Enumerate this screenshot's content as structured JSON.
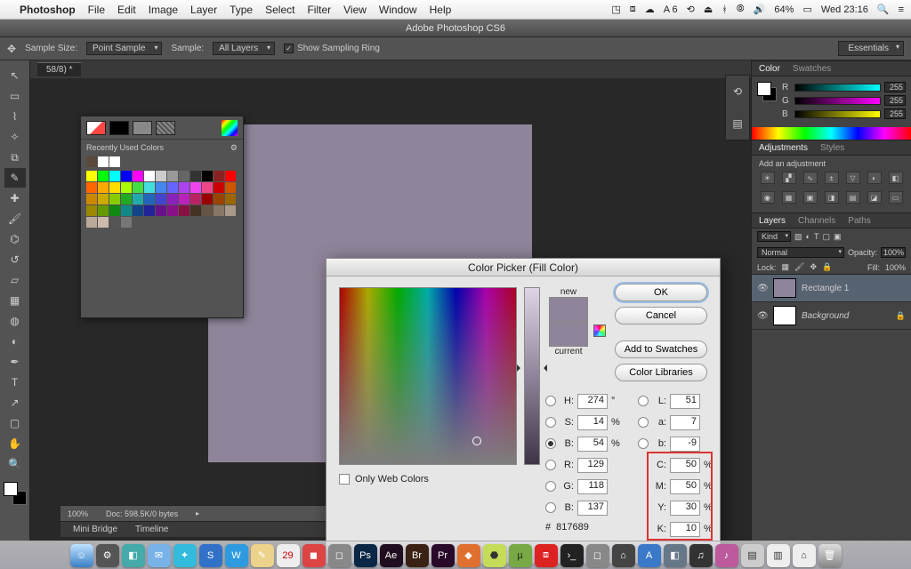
{
  "menubar": {
    "app_name": "Photoshop",
    "items": [
      "File",
      "Edit",
      "Image",
      "Layer",
      "Type",
      "Select",
      "Filter",
      "View",
      "Window",
      "Help"
    ],
    "battery": "64%",
    "clock": "Wed 23:16"
  },
  "app_title": "Adobe Photoshop CS6",
  "options": {
    "sample_size_label": "Sample Size:",
    "sample_size_value": "Point Sample",
    "sample_label": "Sample:",
    "sample_value": "All Layers",
    "show_sampling_ring": "Show Sampling Ring",
    "workspace": "Essentials"
  },
  "doc_tab": "58/8) *",
  "recent_panel_title": "Recently Used Colors",
  "right": {
    "color_tab": "Color",
    "swatches_tab": "Swatches",
    "rgb": {
      "r_label": "R",
      "r_val": "255",
      "g_label": "G",
      "g_val": "255",
      "b_label": "B",
      "b_val": "255"
    },
    "adjustments_tab": "Adjustments",
    "styles_tab": "Styles",
    "add_adjustment": "Add an adjustment",
    "layers_tab": "Layers",
    "channels_tab": "Channels",
    "paths_tab": "Paths",
    "kind": "Kind",
    "blend_mode": "Normal",
    "opacity_label": "Opacity:",
    "opacity_val": "100%",
    "lock_label": "Lock:",
    "fill_label": "Fill:",
    "fill_val": "100%",
    "layer1": "Rectangle 1",
    "layer2": "Background"
  },
  "status": {
    "zoom": "100%",
    "doc": "Doc: 598.5K/0 bytes"
  },
  "mini_tabs": {
    "a": "Mini Bridge",
    "b": "Timeline"
  },
  "picker": {
    "title": "Color Picker (Fill Color)",
    "new_label": "new",
    "current_label": "current",
    "ok": "OK",
    "cancel": "Cancel",
    "add_swatches": "Add to Swatches",
    "libraries": "Color Libraries",
    "web_only": "Only Web Colors",
    "H": {
      "l": "H:",
      "v": "274",
      "u": "°"
    },
    "S": {
      "l": "S:",
      "v": "14",
      "u": "%"
    },
    "Br": {
      "l": "B:",
      "v": "54",
      "u": "%"
    },
    "R": {
      "l": "R:",
      "v": "129",
      "u": ""
    },
    "G": {
      "l": "G:",
      "v": "118",
      "u": ""
    },
    "Bc": {
      "l": "B:",
      "v": "137",
      "u": ""
    },
    "L": {
      "l": "L:",
      "v": "51",
      "u": ""
    },
    "a": {
      "l": "a:",
      "v": "7",
      "u": ""
    },
    "b": {
      "l": "b:",
      "v": "-9",
      "u": ""
    },
    "C": {
      "l": "C:",
      "v": "50",
      "u": "%"
    },
    "M": {
      "l": "M:",
      "v": "50",
      "u": "%"
    },
    "Y": {
      "l": "Y:",
      "v": "30",
      "u": "%"
    },
    "K": {
      "l": "K:",
      "v": "10",
      "u": "%"
    },
    "hex_label": "#",
    "hex": "817689"
  }
}
